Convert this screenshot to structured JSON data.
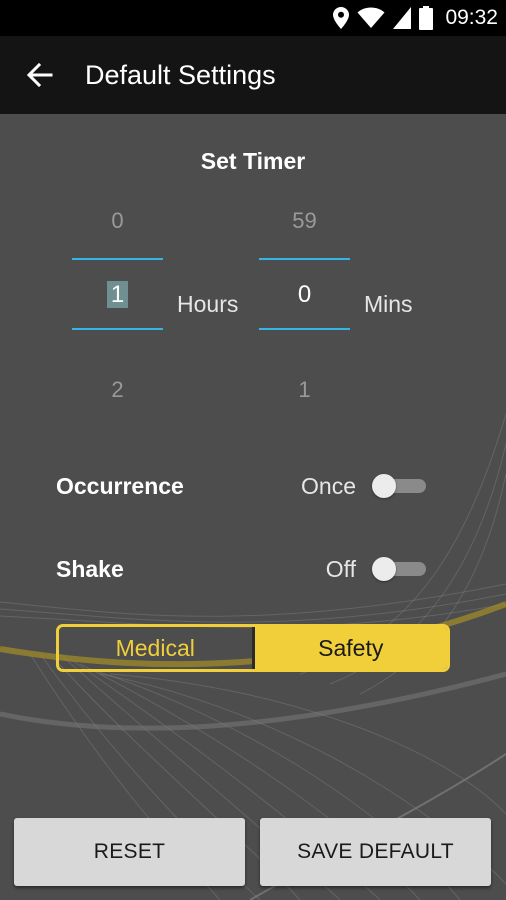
{
  "status_bar": {
    "time": "09:32",
    "icons": [
      "location-icon",
      "wifi-icon",
      "signal-icon",
      "battery-icon"
    ]
  },
  "app_bar": {
    "title": "Default Settings",
    "back_icon": "arrow-left-icon"
  },
  "timer": {
    "title": "Set Timer",
    "hours": {
      "prev": "0",
      "current": "1",
      "next": "2",
      "unit": "Hours"
    },
    "minutes": {
      "prev": "59",
      "current": "0",
      "next": "1",
      "unit": "Mins"
    }
  },
  "settings": {
    "occurrence": {
      "label": "Occurrence",
      "value": "Once",
      "enabled": false
    },
    "shake": {
      "label": "Shake",
      "value": "Off",
      "enabled": false
    }
  },
  "mode": {
    "options": [
      "Medical",
      "Safety"
    ],
    "selected": "Safety"
  },
  "buttons": {
    "reset": "RESET",
    "save_default": "SAVE DEFAULT"
  },
  "colors": {
    "accent_yellow": "#f0cf3a",
    "picker_line_blue": "#33b5e5",
    "background": "#4d4d4d",
    "app_bar": "#141414"
  }
}
